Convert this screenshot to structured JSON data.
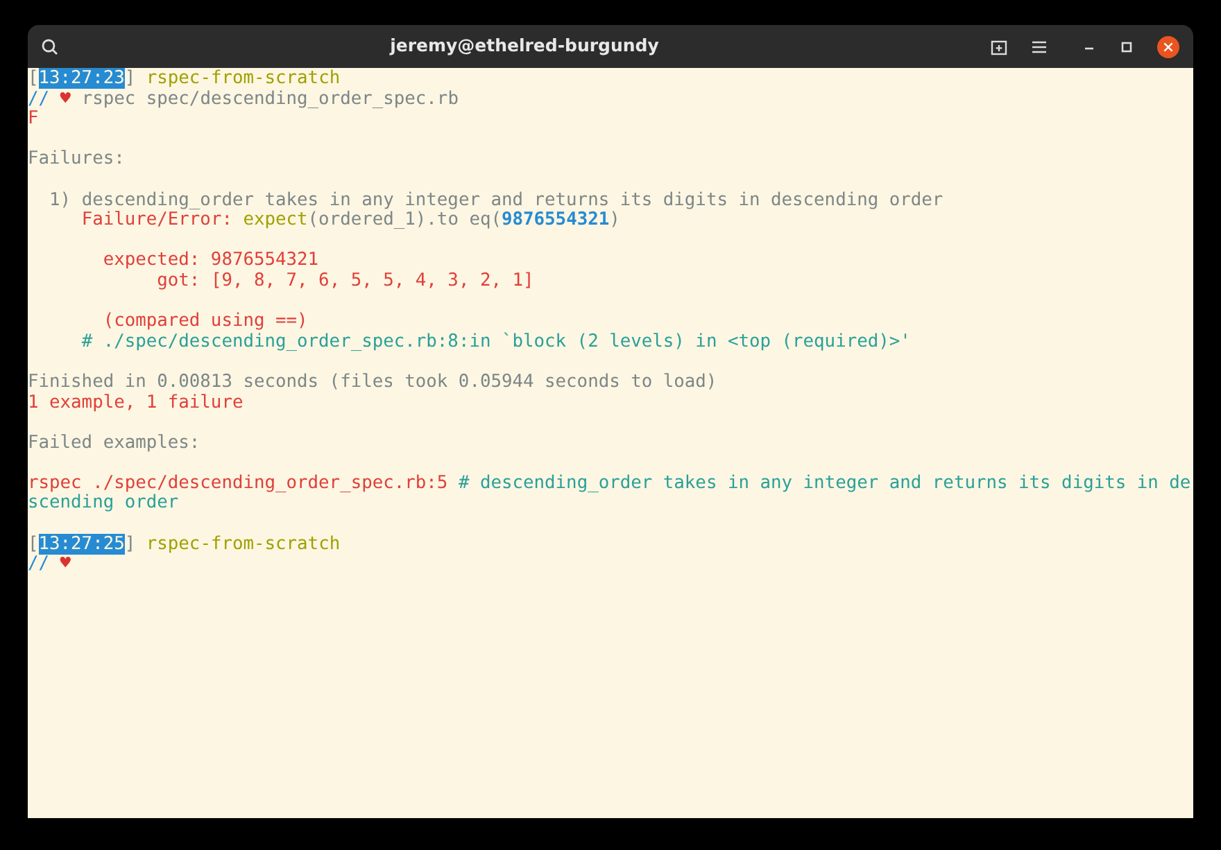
{
  "window": {
    "title": "jeremy@ethelred-burgundy"
  },
  "terminal": {
    "lines": [
      {
        "kind": "text",
        "segments": [
          {
            "kind": "bracket",
            "text": "["
          },
          {
            "kind": "time",
            "text": "13:27:23"
          },
          {
            "kind": "bracket",
            "text": "] "
          },
          {
            "kind": "green",
            "text": "rspec-from-scratch"
          }
        ]
      },
      {
        "kind": "text",
        "segments": [
          {
            "kind": "blue",
            "text": "// "
          },
          {
            "kind": "heart",
            "text": "♥"
          },
          {
            "kind": "plain",
            "text": " rspec spec/descending_order_spec.rb"
          }
        ]
      },
      {
        "kind": "text",
        "segments": [
          {
            "kind": "red",
            "text": "F"
          }
        ]
      },
      {
        "kind": "blank"
      },
      {
        "kind": "text",
        "segments": [
          {
            "kind": "plain",
            "text": "Failures:"
          }
        ]
      },
      {
        "kind": "blank"
      },
      {
        "kind": "text",
        "segments": [
          {
            "kind": "plain",
            "text": "  1) descending_order takes in any integer and returns its digits in descending order"
          }
        ]
      },
      {
        "kind": "text",
        "segments": [
          {
            "kind": "red",
            "text": "     Failure/Error:"
          },
          {
            "kind": "green",
            "text": " expect"
          },
          {
            "kind": "plain",
            "text": "(ordered_1).to eq("
          },
          {
            "kind": "number",
            "text": "9876554321"
          },
          {
            "kind": "plain",
            "text": ")"
          }
        ]
      },
      {
        "kind": "blank"
      },
      {
        "kind": "text",
        "segments": [
          {
            "kind": "red",
            "text": "       expected: 9876554321"
          }
        ]
      },
      {
        "kind": "text",
        "segments": [
          {
            "kind": "red",
            "text": "            got: [9, 8, 7, 6, 5, 5, 4, 3, 2, 1]"
          }
        ]
      },
      {
        "kind": "blank"
      },
      {
        "kind": "text",
        "segments": [
          {
            "kind": "red",
            "text": "       (compared using ==)"
          }
        ]
      },
      {
        "kind": "text",
        "segments": [
          {
            "kind": "cyan",
            "text": "     # ./spec/descending_order_spec.rb:8:in `block (2 levels) in <top (required)>'"
          }
        ]
      },
      {
        "kind": "blank"
      },
      {
        "kind": "text",
        "segments": [
          {
            "kind": "plain",
            "text": "Finished in 0.00813 seconds (files took 0.05944 seconds to load)"
          }
        ]
      },
      {
        "kind": "text",
        "segments": [
          {
            "kind": "red",
            "text": "1 example, 1 failure"
          }
        ]
      },
      {
        "kind": "blank"
      },
      {
        "kind": "text",
        "segments": [
          {
            "kind": "plain",
            "text": "Failed examples:"
          }
        ]
      },
      {
        "kind": "blank"
      },
      {
        "kind": "wrapped",
        "segments": [
          {
            "kind": "red",
            "text": "rspec ./spec/descending_order_spec.rb:5"
          },
          {
            "kind": "cyan",
            "text": " # descending_order takes in any integer and returns its digits in descending order"
          }
        ]
      },
      {
        "kind": "blank"
      },
      {
        "kind": "text",
        "segments": [
          {
            "kind": "bracket",
            "text": "["
          },
          {
            "kind": "time",
            "text": "13:27:25"
          },
          {
            "kind": "bracket",
            "text": "] "
          },
          {
            "kind": "green",
            "text": "rspec-from-scratch"
          }
        ]
      },
      {
        "kind": "text",
        "segments": [
          {
            "kind": "blue",
            "text": "// "
          },
          {
            "kind": "heart",
            "text": "♥"
          }
        ]
      }
    ]
  }
}
